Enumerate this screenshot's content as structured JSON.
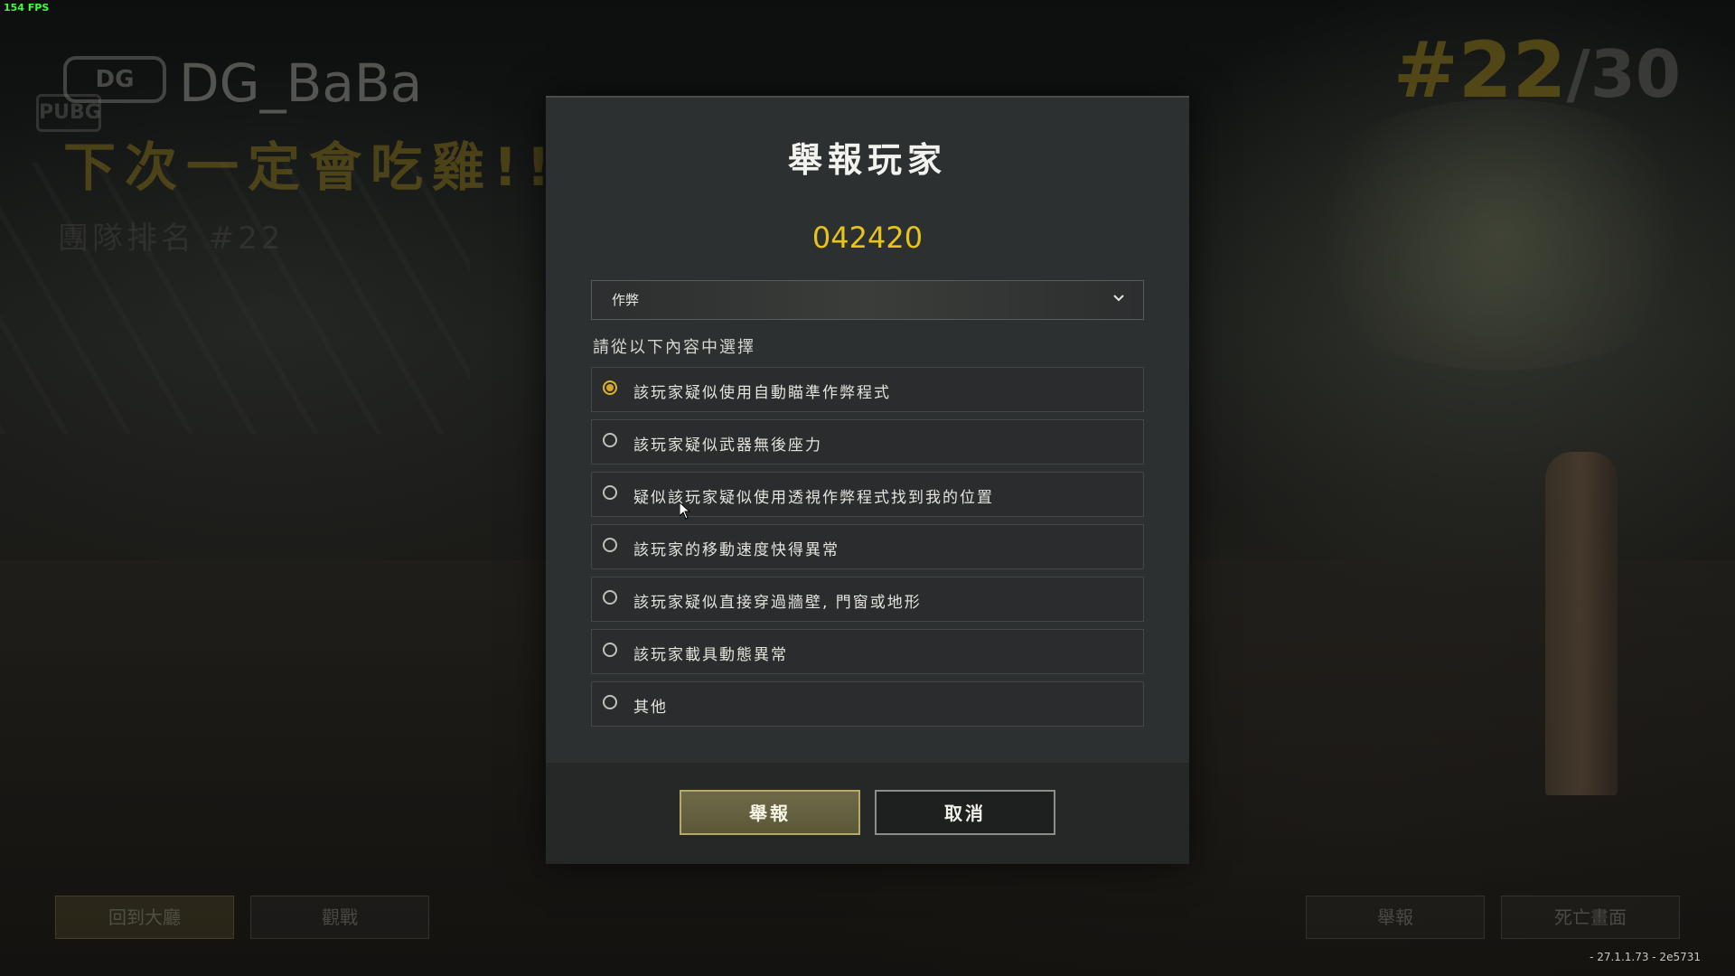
{
  "overlay": {
    "fps": "154 FPS",
    "version": "- 27.1.1.73 - 2e5731"
  },
  "background": {
    "logo_text": "DG",
    "logo_sub_text": "PUBG",
    "player_name": "DG_BaBa",
    "slogan": "下次一定會吃雞!!",
    "faint_line": "團隊排名 #22",
    "rank_current": "#22",
    "rank_total": "/30",
    "buttons": {
      "lobby": "回到大廳",
      "spectate": "觀戰",
      "report": "舉報",
      "death_cam": "死亡畫面"
    }
  },
  "dialog": {
    "title": "舉報玩家",
    "target_player": "042420",
    "category_dropdown": {
      "selected": "作弊",
      "icon": "chevron-down-icon"
    },
    "prompt": "請從以下內容中選擇",
    "selected_index": 0,
    "options": [
      "該玩家疑似使用自動瞄準作弊程式",
      "該玩家疑似武器無後座力",
      "疑似該玩家疑似使用透視作弊程式找到我的位置",
      "該玩家的移動速度快得異常",
      "該玩家疑似直接穿過牆壁, 門窗或地形",
      "該玩家載具動態異常",
      "其他"
    ],
    "buttons": {
      "report": "舉報",
      "cancel": "取消"
    }
  },
  "colors": {
    "accent_gold": "#e8c419",
    "radio_selected": "#d4a826",
    "dialog_bg": "#2d3031"
  }
}
